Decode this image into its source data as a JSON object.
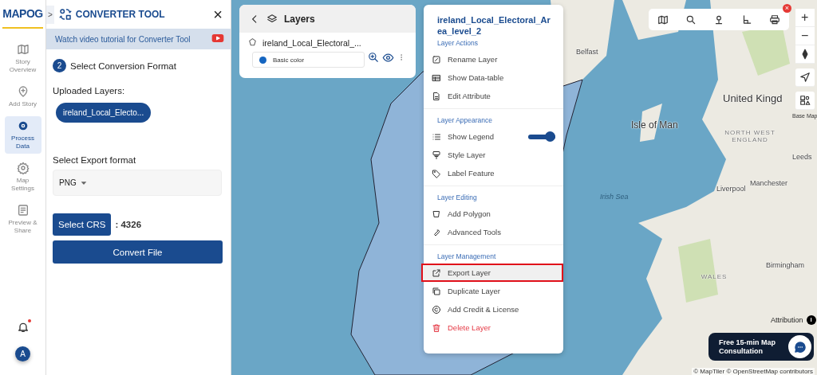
{
  "brand": {
    "logo": "MAPOG"
  },
  "rail": {
    "items": [
      {
        "label": "Story Overview",
        "selected": false
      },
      {
        "label": "Add Story",
        "selected": false
      },
      {
        "label": "Process Data",
        "selected": true
      },
      {
        "label": "Map Settings",
        "selected": false
      },
      {
        "label": "Preview & Share",
        "selected": false
      }
    ],
    "notification": {
      "unread": true
    },
    "avatar": {
      "initial": "A"
    }
  },
  "panel": {
    "collapse": ">",
    "close": "×",
    "title": "CONVERTER TOOL",
    "tutorial": "Watch video tutorial for Converter Tool",
    "step": {
      "number": "2",
      "label": "Select Conversion Format"
    },
    "uploaded_label": "Uploaded Layers:",
    "layers": [
      "ireland_Local_Electo..."
    ],
    "export_label": "Select Export format",
    "format": "PNG",
    "crs_button": "Select CRS",
    "crs_value": ": 4326",
    "convert_button": "Convert File"
  },
  "layers_panel": {
    "title": "Layers",
    "layer": {
      "name": "ireland_Local_Electoral_...",
      "style": "Basic color"
    }
  },
  "context_menu": {
    "title": "ireland_Local_Electoral_Area_level_2",
    "sections": [
      {
        "heading": "Layer Actions",
        "items": [
          {
            "label": "Rename Layer",
            "kind": "action",
            "highlighted": false
          },
          {
            "label": "Show Data-table",
            "kind": "action",
            "highlighted": false
          },
          {
            "label": "Edit Attribute",
            "kind": "action",
            "highlighted": false
          }
        ]
      },
      {
        "heading": "Layer Appearance",
        "items": [
          {
            "label": "Show Legend",
            "kind": "toggle",
            "on": true,
            "highlighted": false
          },
          {
            "label": "Style Layer",
            "kind": "action",
            "highlighted": false
          },
          {
            "label": "Label Feature",
            "kind": "action",
            "highlighted": false
          }
        ]
      },
      {
        "heading": "Layer Editing",
        "items": [
          {
            "label": "Add Polygon",
            "kind": "action",
            "highlighted": false
          },
          {
            "label": "Advanced Tools",
            "kind": "action",
            "highlighted": false
          }
        ]
      },
      {
        "heading": "Layer Management",
        "items": [
          {
            "label": "Export Layer",
            "kind": "action",
            "highlighted": true
          },
          {
            "label": "Duplicate Layer",
            "kind": "action",
            "highlighted": false
          },
          {
            "label": "Add Credit & License",
            "kind": "action",
            "highlighted": false
          },
          {
            "label": "Delete Layer",
            "kind": "danger",
            "highlighted": false
          }
        ]
      }
    ]
  },
  "map": {
    "labels": [
      "Belfast",
      "Isle of Man",
      "United Kingd",
      "Irish Sea",
      "NORTH WEST ENGLAND",
      "Leeds",
      "Liverpool",
      "Manchester",
      "WALES",
      "Birmingham"
    ],
    "toolbar_close": "×",
    "info": "i",
    "zoom_in": "+",
    "zoom_out": "−",
    "base_map_label": "Base Map",
    "attribution": "Attribution",
    "consultation": "Free 15-min Map Consultation",
    "credits": "© MapTiler © OpenStreetMap contributors"
  }
}
